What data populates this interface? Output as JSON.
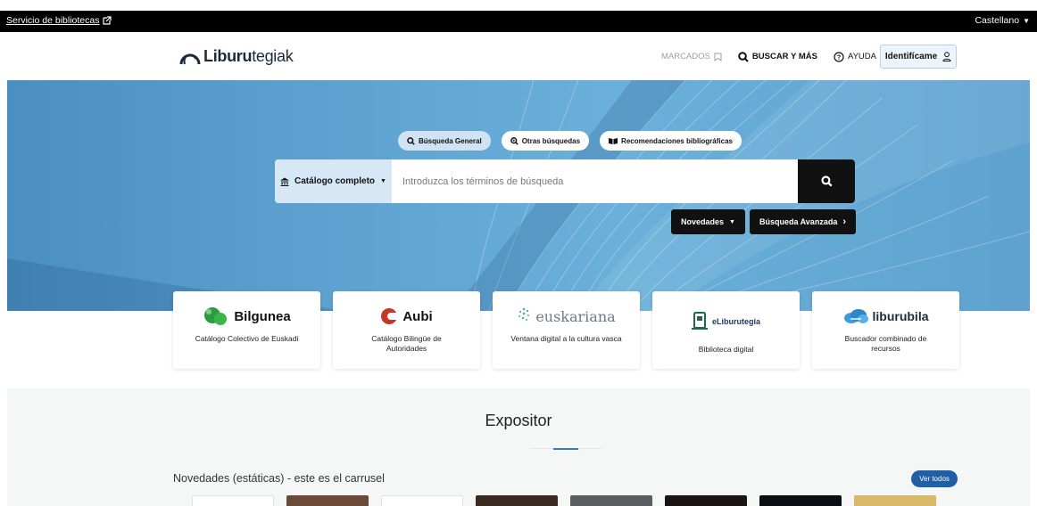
{
  "topbar": {
    "service_link": "Servicio de bibliotecas",
    "language": "Castellano"
  },
  "header": {
    "logo_bold": "Liburu",
    "logo_light": "tegiak",
    "nav": {
      "marcados": "MARCADOS",
      "buscar": "BUSCAR Y MÁS",
      "ayuda": "AYUDA",
      "identify": "Identifícame"
    }
  },
  "search": {
    "tabs": [
      "Búsqueda General",
      "Otras búsquedas",
      "Recomendaciones bibliográficas"
    ],
    "catalog_select": "Catálogo completo",
    "placeholder": "Introduzca los términos de búsqueda",
    "novedades": "Novedades",
    "advanced": "Búsqueda Avanzada"
  },
  "cards": [
    {
      "brand": "Bilgunea",
      "desc": "Catálogo Colectivo de Euskadi",
      "icon": "bilgunea-logo-icon"
    },
    {
      "brand": "Aubi",
      "desc": "Catálogo Bilingüe de Autoridades",
      "icon": "aubi-logo-icon"
    },
    {
      "brand": "euskariana",
      "desc": "Ventana digital a la cultura vasca",
      "icon": "euskariana-logo-icon"
    },
    {
      "brand": "eLiburutegia",
      "desc": "Biblioteca digital",
      "icon": "eliburutegia-logo-icon"
    },
    {
      "brand": "liburubila",
      "desc": "Buscador combinado de recursos",
      "icon": "liburubila-logo-icon"
    }
  ],
  "expositor": {
    "title": "Expositor",
    "carousel_title": "Novedades (estáticas) - este es el carrusel",
    "see_all": "Ver todos",
    "cover_colors": [
      "#ffffff",
      "#6b4a3a",
      "#ffffff",
      "#3a2a22",
      "#5a5e60",
      "#1a1414",
      "#0d0d14",
      "#d9b86a"
    ]
  },
  "colors": {
    "accent": "#1f5fa6",
    "hero": "#5fa4d1",
    "dark": "#111111"
  }
}
